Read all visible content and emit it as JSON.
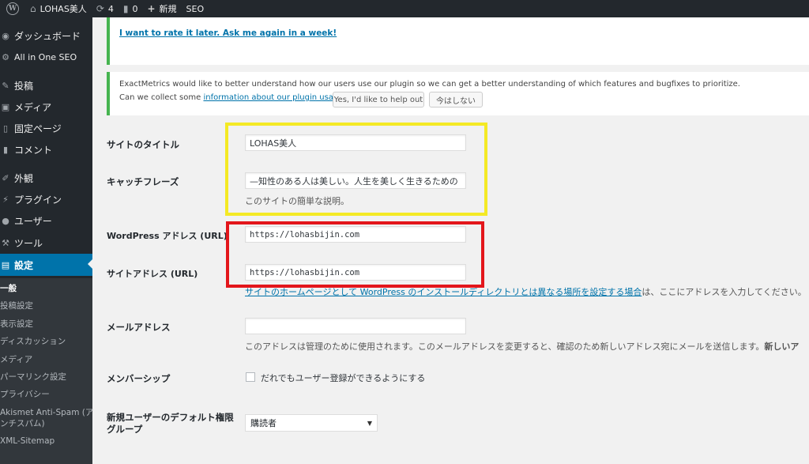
{
  "admin_bar": {
    "site_name": "LOHAS美人",
    "updates_count": "4",
    "comments_count": "0",
    "new_label": "新規",
    "seo_label": "SEO"
  },
  "sidebar": {
    "items": [
      {
        "label": "ダッシュボード",
        "icon": "dashboard-icon"
      },
      {
        "label": "All in One SEO",
        "icon": "gear-icon"
      },
      {
        "label": "投稿",
        "icon": "pin-icon"
      },
      {
        "label": "メディア",
        "icon": "media-icon"
      },
      {
        "label": "固定ページ",
        "icon": "page-icon"
      },
      {
        "label": "コメント",
        "icon": "comment-icon"
      },
      {
        "label": "外観",
        "icon": "brush-icon"
      },
      {
        "label": "プラグイン",
        "icon": "plugin-icon"
      },
      {
        "label": "ユーザー",
        "icon": "user-icon"
      },
      {
        "label": "ツール",
        "icon": "wrench-icon"
      },
      {
        "label": "設定",
        "icon": "settings-icon"
      }
    ],
    "submenu": [
      "一般",
      "投稿設定",
      "表示設定",
      "ディスカッション",
      "メディア",
      "パーマリンク設定",
      "プライバシー",
      "Akismet Anti-Spam (ア",
      "ンチスパム)",
      "XML-Sitemap"
    ]
  },
  "notices": {
    "rate_later": "I want to rate it later. Ask me again in a week!",
    "em_line1": "ExactMetrics would like to better understand how our users use our plugin so we can get a better understanding of which features and bugfixes to prioritize.",
    "em_line2_prefix": "Can we collect some ",
    "em_line2_link": "information about our plugin usage?",
    "btn_yes": "Yes, I'd like to help out",
    "btn_no": "今はしない"
  },
  "form": {
    "site_title_label": "サイトのタイトル",
    "site_title_value": "LOHAS美人",
    "tagline_label": "キャッチフレーズ",
    "tagline_value": "—知性のある人は美しい。人生を美しく生きるための",
    "tagline_desc": "このサイトの簡単な説明。",
    "wp_address_label": "WordPress アドレス (URL)",
    "wp_address_value": "https://lohasbijin.com",
    "site_address_label": "サイトアドレス (URL)",
    "site_address_value": "https://lohasbijin.com",
    "site_address_desc_link": "サイトのホームページとして WordPress のインストールディレクトリとは異なる場所を設定する場合",
    "site_address_desc_rest": "は、ここにアドレスを入力してください。",
    "email_label": "メールアドレス",
    "email_value": "",
    "email_desc": "このアドレスは管理のために使用されます。このメールアドレスを変更すると、確認のため新しいアドレス宛にメールを送信します。",
    "email_desc_bold": "新しいア",
    "membership_label": "メンバーシップ",
    "membership_checkbox_label": "だれでもユーザー登録ができるようにする",
    "membership_checked": false,
    "default_role_label_line1": "新規ユーザーのデフォルト権限",
    "default_role_label_line2": "グループ",
    "default_role_value": "購読者"
  },
  "highlight_colors": {
    "yellow": "#f4e925",
    "red": "#e3161b"
  }
}
